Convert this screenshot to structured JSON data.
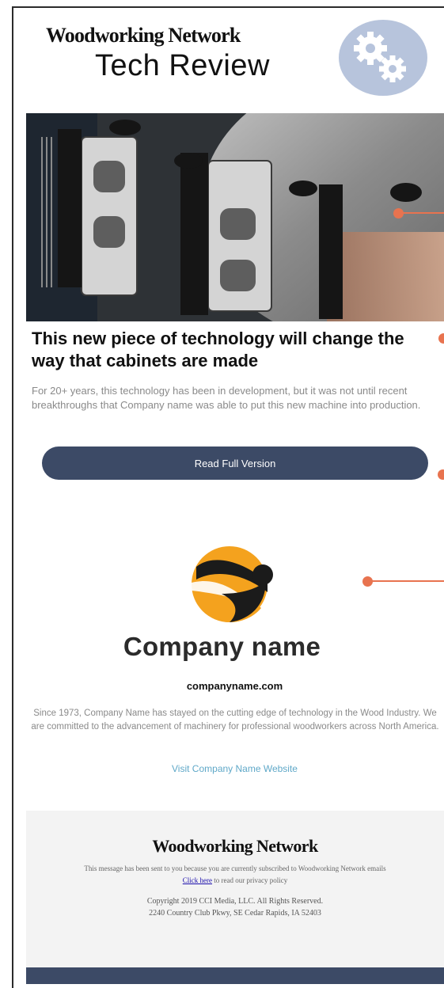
{
  "header": {
    "brand": "Woodworking Network",
    "subtitle": "Tech Review",
    "badge_icon": "gears-icon"
  },
  "article": {
    "headline": "This new piece of technology will change the way that cabinets are made",
    "summary": "For 20+ years, this technology has been in development, but it was not until recent breakthroughs that Company name was able to put this new machine into production.",
    "cta_label": "Read Full Version"
  },
  "company": {
    "logo_text": "Company name",
    "domain": "companyname.com",
    "about": "Since 1973, Company Name has stayed on the cutting edge of technology in the Wood Industry. We are committed to the advancement of machinery for professional woodworkers across North America.",
    "link_label": "Visit Company Name Website"
  },
  "footer": {
    "brand": "Woodworking Network",
    "subscribed_note": "This message has been sent to you because you are currently subscribed to Woodworking Network emails",
    "privacy_link": "Click here",
    "privacy_rest": " to read our privacy policy",
    "copyright": "Copyright 2019 CCI Media, LLC. All Rights Reserved.",
    "address": "2240 Country Club Pkwy, SE Cedar Rapids, IA 52403"
  },
  "colors": {
    "accent": "#3c4a66",
    "badge": "#b7c4dc",
    "marker": "#e8734f",
    "link": "#5fa8c8",
    "logo_orange": "#f4a21e"
  }
}
